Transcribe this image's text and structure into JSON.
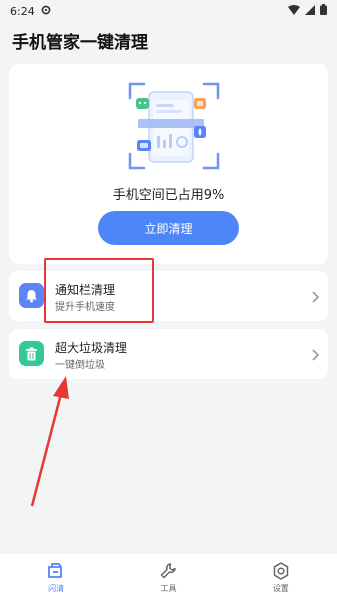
{
  "status": {
    "time": "6:24"
  },
  "app": {
    "title": "手机管家一键清理"
  },
  "hero": {
    "usage_text": "手机空间已占用9%",
    "clean_button": "立即清理"
  },
  "menu": [
    {
      "label": "通知栏清理",
      "sub": "提升手机速度",
      "icon": "bell-icon",
      "color": "#5b84f5"
    },
    {
      "label": "超大垃圾清理",
      "sub": "一键倒垃圾",
      "icon": "trash-icon",
      "color": "#33c79a"
    }
  ],
  "annotation": {
    "highlight_color": "#e53935"
  },
  "nav": [
    {
      "label": "闪清",
      "icon": "flash-clean-icon",
      "active": true
    },
    {
      "label": "工具",
      "icon": "wrench-icon",
      "active": false
    },
    {
      "label": "设置",
      "icon": "settings-icon",
      "active": false
    }
  ],
  "colors": {
    "accent": "#4f86f7",
    "background": "#f3f4f6"
  }
}
